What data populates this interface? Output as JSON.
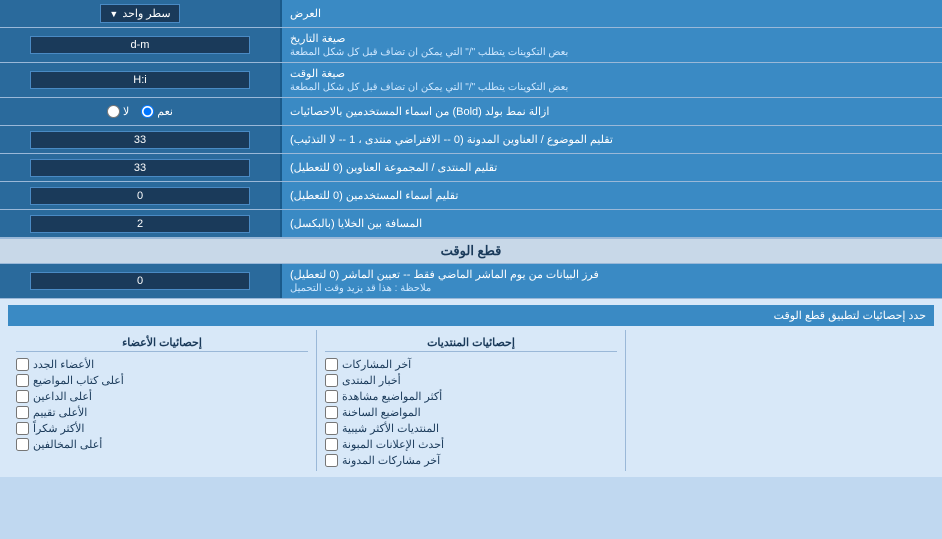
{
  "topRow": {
    "label": "العرض",
    "dropdownLabel": "سطر واحد",
    "dropdownArrow": "▼"
  },
  "rows": [
    {
      "id": "date-format",
      "label": "صيغة التاريخ",
      "subLabel": "بعض التكوينات يتطلب \"/\" التي يمكن ان تضاف قبل كل شكل المطعة",
      "inputValue": "d-m",
      "type": "text"
    },
    {
      "id": "time-format",
      "label": "صيغة الوقت",
      "subLabel": "بعض التكوينات يتطلب \"/\" التي يمكن ان تضاف قبل كل شكل المطعة",
      "inputValue": "H:i",
      "type": "text"
    },
    {
      "id": "bold-remove",
      "label": "ازالة نمط بولد (Bold) من اسماء المستخدمين بالاحصائيات",
      "radioOptions": [
        "نعم",
        "لا"
      ],
      "radioSelected": "نعم",
      "type": "radio"
    },
    {
      "id": "topic-titles",
      "label": "تقليم الموضوع / العناوين المدونة (0 -- الافتراضي منتدى ، 1 -- لا التذئيب)",
      "inputValue": "33",
      "type": "text"
    },
    {
      "id": "forum-titles",
      "label": "تقليم المنتدى / المجموعة العناوين (0 للتعطيل)",
      "inputValue": "33",
      "type": "text"
    },
    {
      "id": "usernames-trim",
      "label": "تقليم أسماء المستخدمين (0 للتعطيل)",
      "inputValue": "0",
      "type": "text"
    },
    {
      "id": "cell-spacing",
      "label": "المسافة بين الخلايا (بالبكسل)",
      "inputValue": "2",
      "type": "text"
    }
  ],
  "cutoffSection": {
    "title": "قطع الوقت",
    "row": {
      "id": "cutoff-days",
      "label": "فرز البيانات من يوم الماشر الماضي فقط -- تعيين الماشر (0 لتعطيل)",
      "subLabel": "ملاحظة : هذا قد يزيد وقت التحميل",
      "inputValue": "0",
      "type": "text"
    },
    "checkboxesHeader": "حدد إحصائيات لتطبيق قطع الوقت",
    "columns": [
      {
        "id": "col-members",
        "header": "إحصائيات الأعضاء",
        "items": [
          "الأعضاء الجدد",
          "أعلى كتاب المواضيع",
          "أعلى الداعين",
          "الأعلى تقييم",
          "الأكثر شكراً",
          "أعلى المخالفين"
        ]
      },
      {
        "id": "col-posts",
        "header": "إحصائيات المنتديات",
        "items": [
          "آخر المشاركات",
          "أخبار المنتدى",
          "أكثر المواضيع مشاهدة",
          "المواضيع الساخنة",
          "المنتديات الأكثر شيبية",
          "أحدث الإعلانات المبونة",
          "آخر مشاركات المدونة"
        ]
      },
      {
        "id": "col-empty",
        "header": "",
        "items": []
      }
    ]
  }
}
